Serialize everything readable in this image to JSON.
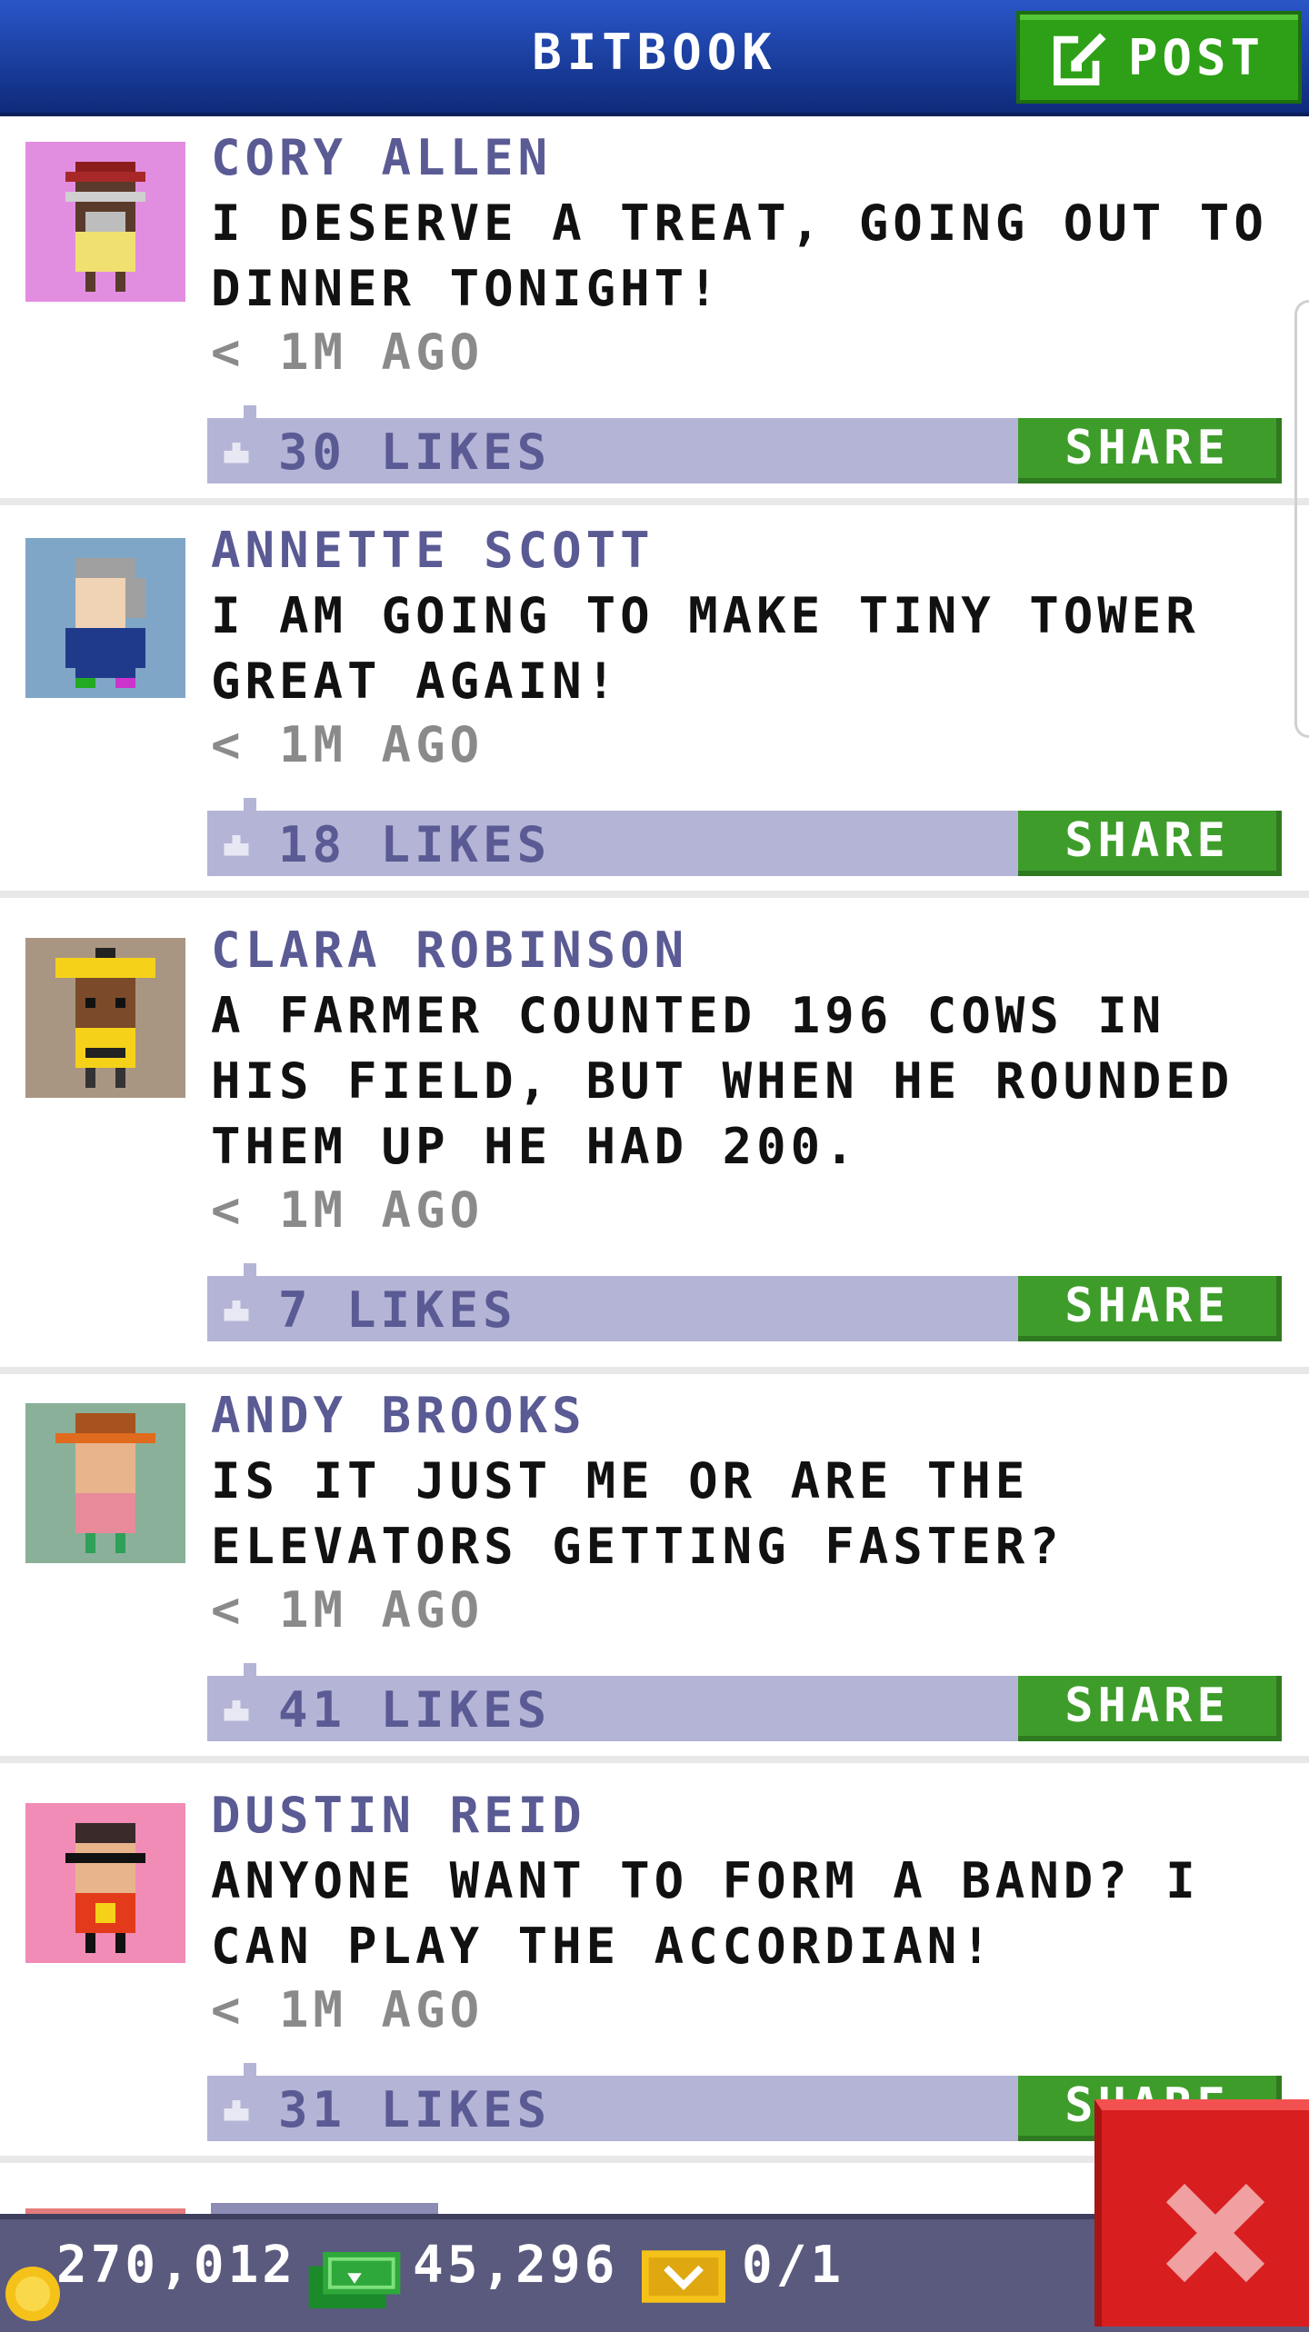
{
  "header": {
    "title": "BITBOOK",
    "post_label": "POST"
  },
  "posts": [
    {
      "author": "CORY ALLEN",
      "message": "I DESERVE A TREAT, GOING OUT TO DINNER TONIGHT!",
      "time": "< 1M AGO",
      "likes": "30 LIKES",
      "share": "SHARE",
      "avatar_bg": "#e28ee0"
    },
    {
      "author": "ANNETTE SCOTT",
      "message": "I AM GOING TO MAKE TINY TOWER GREAT AGAIN!",
      "time": "< 1M AGO",
      "likes": "18 LIKES",
      "share": "SHARE",
      "avatar_bg": "#7fa6c6"
    },
    {
      "author": "CLARA ROBINSON",
      "message": "A FARMER COUNTED 196 COWS IN HIS FIELD, BUT WHEN HE ROUNDED THEM UP HE HAD 200.",
      "time": "< 1M AGO",
      "likes": "7 LIKES",
      "share": "SHARE",
      "avatar_bg": "#a99682"
    },
    {
      "author": "ANDY BROOKS",
      "message": "IS IT JUST ME OR ARE THE ELEVATORS GETTING FASTER?",
      "time": "< 1M AGO",
      "likes": "41 LIKES",
      "share": "SHARE",
      "avatar_bg": "#8ab09a"
    },
    {
      "author": "DUSTIN REID",
      "message": "ANYONE WANT TO FORM A BAND? I CAN PLAY THE ACCORDIAN!",
      "time": "< 1M AGO",
      "likes": "31 LIKES",
      "share": "SHARE",
      "avatar_bg": "#f08cb6"
    }
  ],
  "status": {
    "coins": "270,012",
    "bux": "45,296",
    "tickets": "0/1"
  },
  "colors": {
    "header": "#1b3fa6",
    "accent_green": "#3e9d2a",
    "like_bar": "#b4b4d6",
    "close_red": "#d81e1e"
  },
  "icons": [
    "edit-icon",
    "thumbs-up-icon",
    "coin-icon",
    "cash-icon",
    "ticket-icon",
    "close-icon"
  ]
}
